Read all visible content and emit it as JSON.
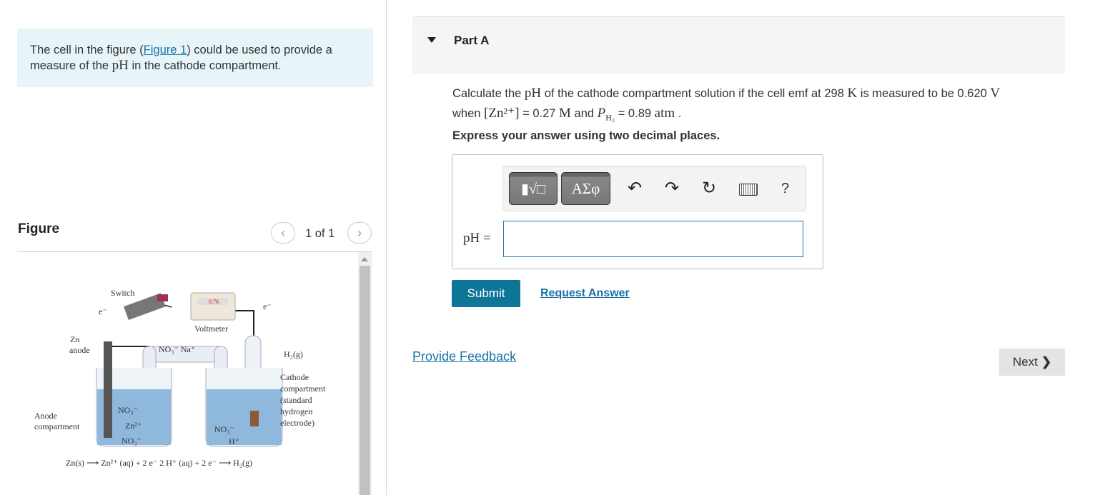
{
  "intro": {
    "before": "The cell in the figure (",
    "link": "Figure 1",
    "after": ") could be used to provide a measure of the ",
    "ph": "pH",
    "after2": " in the cathode compartment."
  },
  "figure": {
    "title": "Figure",
    "pager": "1 of 1",
    "prev_icon": "chevron-left-icon",
    "next_icon": "chevron-right-icon",
    "labels": {
      "switch": "Switch",
      "voltmeter": "Voltmeter",
      "reading": "0.76",
      "e1": "e⁻",
      "e2": "e⁻",
      "zn_anode_1": "Zn",
      "zn_anode_2": "anode",
      "salt": "NO₃⁻  Na⁺",
      "h2": "H₂(g)",
      "cath1": "Cathode",
      "cath2": "compartment",
      "cath3": "(standard",
      "cath4": "hydrogen",
      "cath5": "electrode)",
      "anode1": "Anode",
      "anode2": "compartment",
      "no3a": "NO₃⁻",
      "zn2": "Zn²⁺",
      "no3b": "NO₃⁻",
      "no3c": "NO₃⁻",
      "hplus": "H⁺",
      "eq": "Zn(s) ⟶ Zn²⁺ (aq) + 2 e⁻   2 H⁺ (aq) + 2 e⁻ ⟶ H₂(g)"
    }
  },
  "part": {
    "title": "Part A",
    "toggle_icon": "caret-down-icon"
  },
  "question": {
    "line1a": "Calculate the ",
    "ph": "pH",
    "line1b": " of the cathode compartment solution if the cell emf at 298 ",
    "K": "K",
    "line1c": " is measured to be 0.620 ",
    "V": "V",
    "line2a": "when ",
    "zn": "[Zn²⁺]",
    "line2b": " = 0.27 ",
    "M": "M",
    "line2c": " and ",
    "ph2": "P",
    "ph2sub": "H₂",
    "line2d": " = 0.89 ",
    "atm": "atm",
    "line2e": " .",
    "instruction": "Express your answer using two decimal places."
  },
  "toolbar": {
    "templates_icon": "templates-icon",
    "greek": "ΑΣφ",
    "undo_icon": "undo-icon",
    "redo_icon": "redo-icon",
    "reset_icon": "reset-icon",
    "keyboard_icon": "keyboard-icon",
    "help": "?"
  },
  "answer": {
    "label": "pH =",
    "value": ""
  },
  "actions": {
    "submit": "Submit",
    "request": "Request Answer",
    "feedback": "Provide Feedback",
    "next": "Next"
  },
  "colors": {
    "accent": "#0d7696",
    "link": "#1a73a8",
    "info_bg": "#e8f5f8"
  }
}
